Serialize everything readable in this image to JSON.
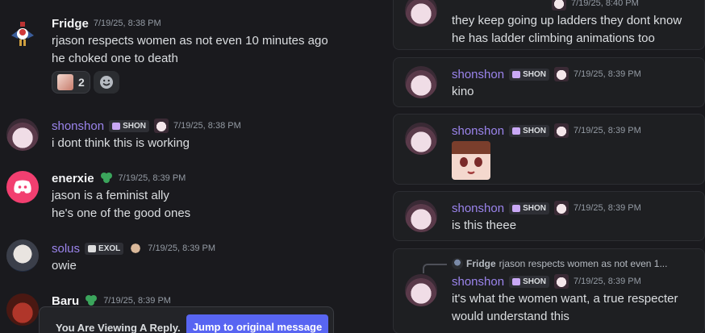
{
  "chat": {
    "messages": [
      {
        "author": "Fridge",
        "timestamp": "7/19/25, 8:38 PM",
        "lines": [
          "rjason respects women as not even 10 minutes ago",
          "he choked one to death"
        ],
        "reactions": [
          {
            "count": "2"
          }
        ]
      },
      {
        "author": "shonshon",
        "tag": "SHON",
        "timestamp": "7/19/25, 8:38 PM",
        "lines": [
          "i dont think this is working"
        ]
      },
      {
        "author": "enerxie",
        "timestamp": "7/19/25, 8:39 PM",
        "lines": [
          "jason is a feminist ally",
          "he's one of the good ones"
        ]
      },
      {
        "author": "solus",
        "tag": "EXOL",
        "timestamp": "7/19/25, 8:39 PM",
        "lines": [
          "owie"
        ]
      },
      {
        "author": "Baru",
        "timestamp": "7/19/25, 8:39 PM",
        "lines": []
      }
    ],
    "banner": {
      "text": "You Are Viewing A Reply.",
      "button": "Jump to original message"
    }
  },
  "panel": {
    "cards": [
      {
        "timestamp": "7/19/25, 8:40 PM",
        "lines": [
          "they keep going up ladders they dont know",
          "he has ladder climbing animations too"
        ]
      },
      {
        "author": "shonshon",
        "tag": "SHON",
        "timestamp": "7/19/25, 8:39 PM",
        "lines": [
          "kino"
        ]
      },
      {
        "author": "shonshon",
        "tag": "SHON",
        "timestamp": "7/19/25, 8:39 PM",
        "lines": []
      },
      {
        "author": "shonshon",
        "tag": "SHON",
        "timestamp": "7/19/25, 8:39 PM",
        "lines": [
          "is this theee"
        ]
      },
      {
        "reply_author": "Fridge",
        "reply_preview": "rjason respects women as not even 1...",
        "author": "shonshon",
        "tag": "SHON",
        "timestamp": "7/19/25, 8:39 PM",
        "lines": [
          "it's what the women want, a true respecter",
          "would understand this"
        ]
      }
    ]
  },
  "colors": {
    "background": "#1a1a1e",
    "card": "#1e1f22",
    "accent": "#5865f2",
    "name_purple": "#9b84ec",
    "name_white": "#f2f3f5",
    "badge_heart": "#c9a8f5",
    "nitro_green": "#3ba55c"
  }
}
